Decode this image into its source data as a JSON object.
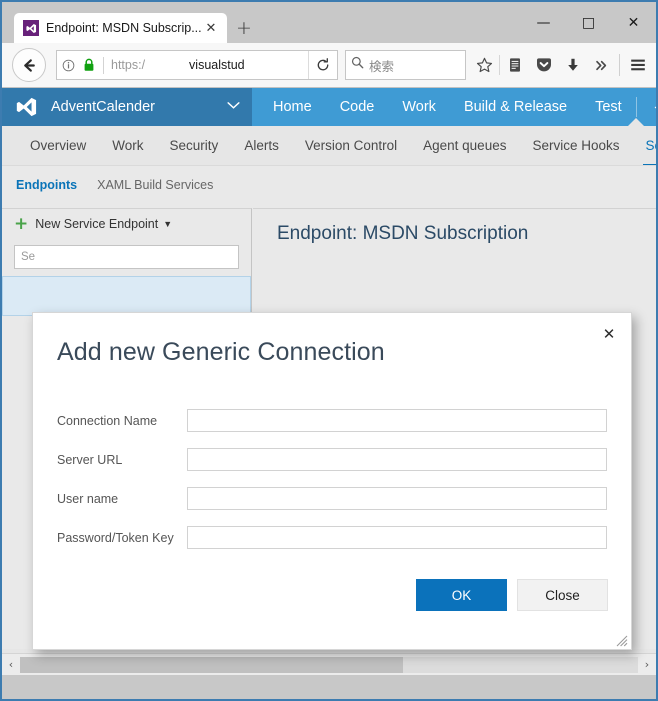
{
  "browser": {
    "tab": {
      "title": "Endpoint: MSDN Subscrip...",
      "favicon": "visual-studio-icon",
      "close_label": "✕"
    },
    "new_tab_label": "+",
    "window_controls": {
      "minimize": "—",
      "maximize": "□",
      "close": "✕"
    },
    "url": {
      "scheme": "https:/",
      "host": "visualstud",
      "lock_icon": "padlock-icon",
      "info_icon": "info-icon"
    },
    "reload_label": "⟳",
    "search": {
      "placeholder": "検索",
      "icon": "search-icon"
    },
    "toolbar_icons": [
      {
        "name": "bookmark-star-icon",
        "glyph": "☆"
      },
      {
        "name": "reading-list-icon",
        "glyph": "☰"
      },
      {
        "name": "pocket-icon",
        "glyph": "♥"
      },
      {
        "name": "downloads-icon",
        "glyph": "⬇"
      },
      {
        "name": "overflow-chevrons-icon",
        "glyph": "»"
      },
      {
        "name": "hamburger-menu-icon",
        "glyph": "≡"
      }
    ],
    "back_label": "←"
  },
  "vsts": {
    "project_name": "AdventCalender",
    "project_chevron": "⌄",
    "logo_icon": "visual-studio-logo",
    "gear_icon": "gear-icon",
    "menu": [
      {
        "label": "Home"
      },
      {
        "label": "Code"
      },
      {
        "label": "Work"
      },
      {
        "label": "Build & Release"
      },
      {
        "label": "Test"
      }
    ],
    "subnav": [
      {
        "label": "Overview",
        "active": false
      },
      {
        "label": "Work",
        "active": false
      },
      {
        "label": "Security",
        "active": false
      },
      {
        "label": "Alerts",
        "active": false
      },
      {
        "label": "Version Control",
        "active": false
      },
      {
        "label": "Agent queues",
        "active": false
      },
      {
        "label": "Service Hooks",
        "active": false
      },
      {
        "label": "Service",
        "active": true
      }
    ],
    "pivots": [
      {
        "label": "Endpoints",
        "active": true
      },
      {
        "label": "XAML Build Services",
        "active": false
      }
    ],
    "new_endpoint_button": "New Service Endpoint",
    "new_endpoint_caret": "▼",
    "plus_icon": "plus-icon",
    "endpoint_search_placeholder": "Se",
    "endpoint_heading": "Endpoint: MSDN Subscription",
    "scrollbar": {
      "left_arrow": "‹",
      "right_arrow": "›"
    }
  },
  "dialog": {
    "title": "Add new Generic Connection",
    "close_icon": "✕",
    "fields": [
      {
        "label": "Connection Name",
        "value": "",
        "placeholder": ""
      },
      {
        "label": "Server URL",
        "value": "",
        "placeholder": ""
      },
      {
        "label": "User name",
        "value": "",
        "placeholder": ""
      },
      {
        "label": "Password/Token Key",
        "value": "",
        "placeholder": ""
      }
    ],
    "ok_label": "OK",
    "close_label": "Close",
    "resize_grip": "resize-grip-icon"
  },
  "colors": {
    "vsts_blue": "#3f9bd4",
    "vsts_blue_dark": "#3279ac",
    "accent_link": "#0a74b8",
    "primary_button": "#0b72bb",
    "plus_green": "#4aa34a",
    "window_border": "#3d7cb0"
  }
}
